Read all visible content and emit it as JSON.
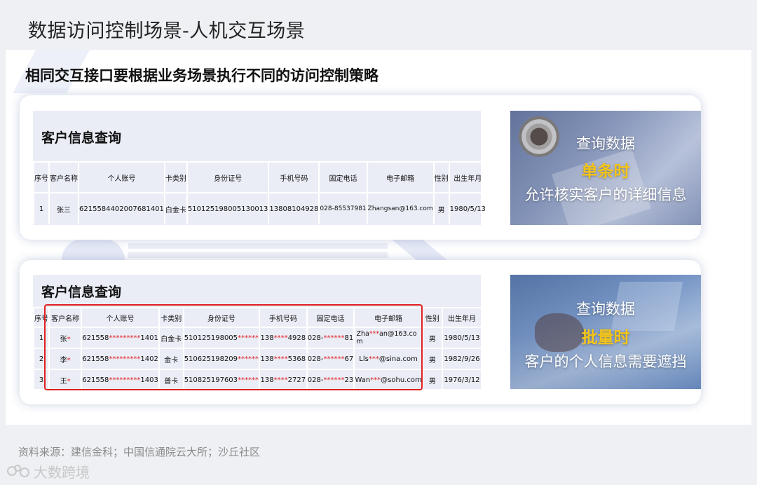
{
  "page_title": "数据访问控制场景-人机交互场景",
  "subtitle": "相同交互接口要根据业务场景执行不同的访问控制策略",
  "columns": [
    "序号",
    "客户名称",
    "个人账号",
    "卡类别",
    "身份证号",
    "手机号码",
    "固定电话",
    "电子邮箱",
    "性别",
    "出生年月"
  ],
  "card_one": {
    "table_title": "客户信息查询",
    "rows": [
      [
        "1",
        "张三",
        "6215584402007681401",
        "白金卡",
        "510125198005130013",
        "13808104928",
        "028-85537981",
        "Zhangsan@163.com",
        "男",
        "1980/5/13"
      ]
    ],
    "photo": {
      "line1": "查询数据",
      "line2": "单条时",
      "line3": "允许核实客户的详细信息"
    }
  },
  "card_two": {
    "table_title": "客户信息查询",
    "rows": [
      {
        "no": "1",
        "name_a": "张",
        "name_m": "*",
        "acct_a": "621558",
        "acct_m": "*********",
        "acct_b": "1401",
        "card": "白金卡",
        "id_a": "510125198005",
        "id_m": "******",
        "tel_a": "138",
        "tel_m": "****",
        "tel_b": "4928",
        "fix_a": "028-",
        "fix_m": "******",
        "fix_b": "81",
        "mail_a": "Zha",
        "mail_m": "***",
        "mail_b": "an@163.co m",
        "sex": "男",
        "birth": "1980/5/13"
      },
      {
        "no": "2",
        "name_a": "李",
        "name_m": "*",
        "acct_a": "621558",
        "acct_m": "*********",
        "acct_b": "1402",
        "card": "金卡",
        "id_a": "510625198209",
        "id_m": "******",
        "tel_a": "138",
        "tel_m": "****",
        "tel_b": "5368",
        "fix_a": "028-",
        "fix_m": "******",
        "fix_b": "67",
        "mail_a": "Lls",
        "mail_m": "***",
        "mail_b": "@sina.com",
        "sex": "男",
        "birth": "1982/9/26"
      },
      {
        "no": "3",
        "name_a": "王",
        "name_m": "*",
        "acct_a": "621558",
        "acct_m": "*********",
        "acct_b": "1403",
        "card": "普卡",
        "id_a": "510825197603",
        "id_m": "******",
        "tel_a": "138",
        "tel_m": "****",
        "tel_b": "2727",
        "fix_a": "028-",
        "fix_m": "******",
        "fix_b": "23",
        "mail_a": "Wan",
        "mail_m": "***",
        "mail_b": "@sohu.com",
        "sex": "男",
        "birth": "1976/3/12"
      }
    ],
    "photo": {
      "line1": "查询数据",
      "line2": "批量时",
      "line3": "客户的个人信息需要遮挡"
    }
  },
  "source": "资料来源：建信金科；中国信通院云大所；沙丘社区",
  "watermark": "大数跨境",
  "colors": {
    "mask_red": "#e02020",
    "highlight_yellow": "#f5c518",
    "table_bg": "#ebedf6"
  }
}
